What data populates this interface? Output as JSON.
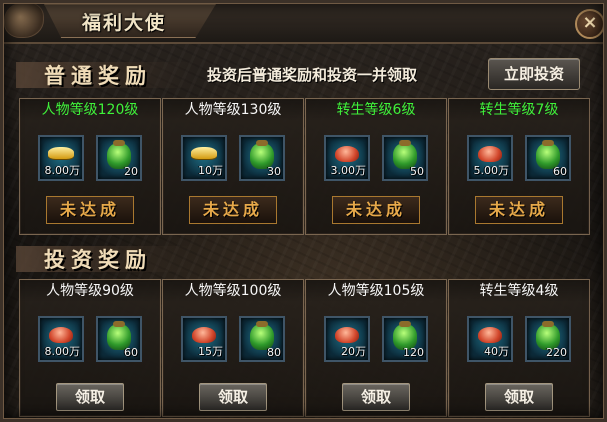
{
  "window": {
    "title": "福利大使",
    "close_label": "×"
  },
  "normal_rewards": {
    "title": "普通奖励",
    "notice": "投资后普通奖励和投资一并领取",
    "invest_button": "立即投资",
    "cards": [
      {
        "label": "人物等级120级",
        "label_color": "green",
        "item1": {
          "icon": "gold-ingot-icon",
          "qty": "8.00万"
        },
        "item2": {
          "icon": "money-bag-icon",
          "qty": "20"
        },
        "status": "未达成"
      },
      {
        "label": "人物等级130级",
        "label_color": "white",
        "item1": {
          "icon": "gold-ingot-icon",
          "qty": "10万"
        },
        "item2": {
          "icon": "money-bag-icon",
          "qty": "30"
        },
        "status": "未达成"
      },
      {
        "label": "转生等级6级",
        "label_color": "green",
        "item1": {
          "icon": "red-gem-icon",
          "qty": "3.00万"
        },
        "item2": {
          "icon": "money-bag-icon",
          "qty": "50"
        },
        "status": "未达成"
      },
      {
        "label": "转生等级7级",
        "label_color": "green",
        "item1": {
          "icon": "red-gem-icon",
          "qty": "5.00万"
        },
        "item2": {
          "icon": "money-bag-icon",
          "qty": "60"
        },
        "status": "未达成"
      }
    ]
  },
  "investment_rewards": {
    "title": "投资奖励",
    "cards": [
      {
        "label": "人物等级90级",
        "item1": {
          "icon": "red-gem-icon",
          "qty": "8.00万"
        },
        "item2": {
          "icon": "money-bag-icon",
          "qty": "60"
        },
        "button": "领取"
      },
      {
        "label": "人物等级100级",
        "item1": {
          "icon": "red-gem-icon",
          "qty": "15万"
        },
        "item2": {
          "icon": "money-bag-icon",
          "qty": "80"
        },
        "button": "领取"
      },
      {
        "label": "人物等级105级",
        "item1": {
          "icon": "red-gem-icon",
          "qty": "20万"
        },
        "item2": {
          "icon": "money-bag-icon",
          "qty": "120"
        },
        "button": "领取"
      },
      {
        "label": "转生等级4级",
        "item1": {
          "icon": "red-gem-icon",
          "qty": "40万"
        },
        "item2": {
          "icon": "money-bag-icon",
          "qty": "220"
        },
        "button": "领取"
      }
    ]
  }
}
